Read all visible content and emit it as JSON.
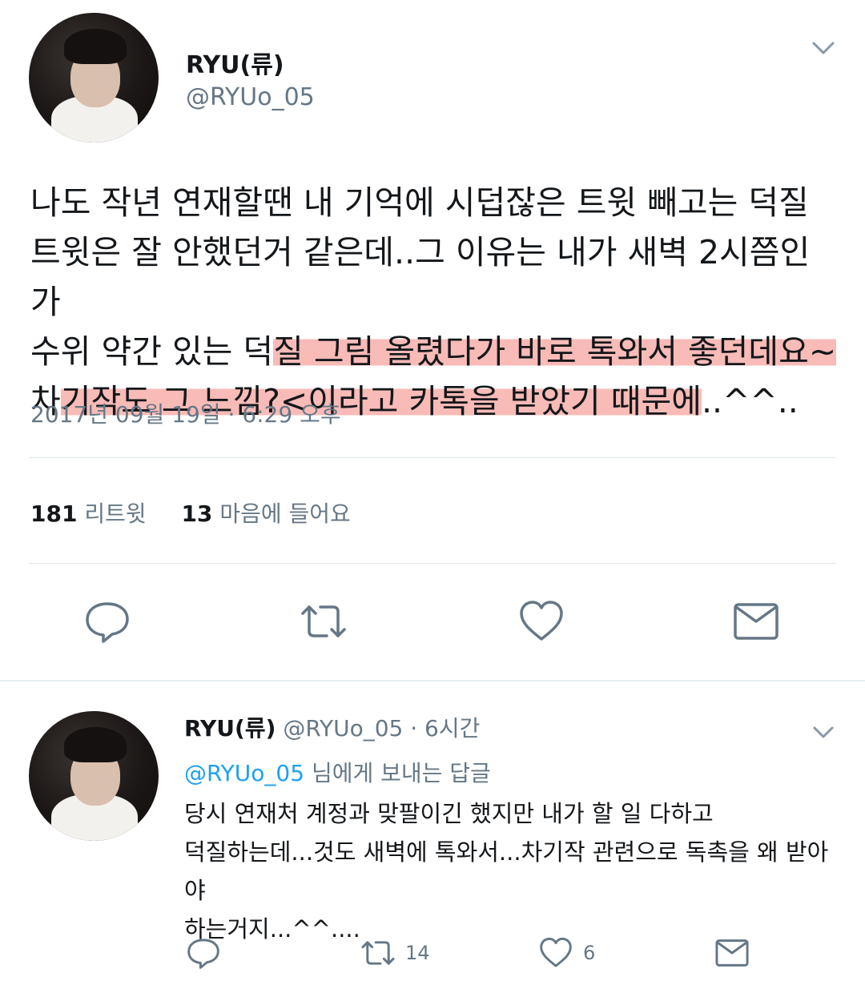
{
  "tweet": {
    "display_name": "RYU(류)",
    "handle": "@RYUo_05",
    "body_lines": [
      [
        "나도 작년 연재할땐 내 기억에 시덥잖은 트윗 빼고는 덕질",
        ""
      ],
      [
        "트윗은 잘 안했던거 같은데..그 이유는 내가 새벽 2시쯤인가",
        ""
      ],
      [
        "수위 약간 있는 덕",
        "질 그림 올렸다가 바로 톡와서 좋던데요~"
      ],
      [
        "차",
        "기작도 그 느낌?<이라고 카톡을 받았기 때문에",
        "..^^.."
      ]
    ],
    "timestamp": "2017년 09월 19일 · 6:29 오후",
    "retweet_count": "181",
    "retweet_label": "리트윗",
    "like_count": "13",
    "like_label": "마음에 들어요"
  },
  "reply": {
    "display_name": "RYU(류)",
    "handle": "@RYUo_05",
    "age": "· 6시간",
    "replying_mention": "@RYUo_05",
    "replying_suffix": "님에게 보내는 답글",
    "body_lines": [
      "당시 연재처 계정과 맞팔이긴 했지만 내가 할 일 다하고",
      "덕질하는데...것도 새벽에 톡와서...차기작 관련으로 독촉을 왜 받아야",
      "하는거지...^^...."
    ],
    "retweet_count": "14",
    "like_count": "6"
  },
  "icons": {
    "chevron": "chevron-down-icon",
    "reply": "reply-icon",
    "retweet": "retweet-icon",
    "like": "heart-icon",
    "dm": "envelope-icon"
  },
  "colors": {
    "text": "#14171a",
    "secondary": "#657786",
    "link": "#1da1f2",
    "highlight": "#f6aaa5",
    "divider": "#e1e8ed"
  }
}
